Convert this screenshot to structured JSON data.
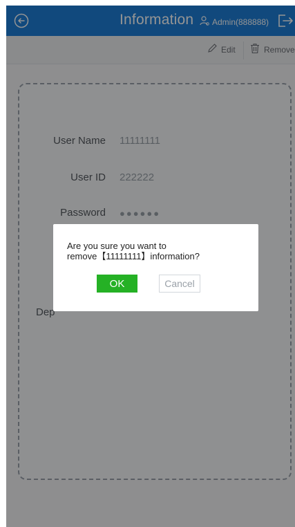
{
  "header": {
    "title": "Information",
    "user": "Admin(888888)"
  },
  "toolbar": {
    "edit_label": "Edit",
    "remove_label": "Remove"
  },
  "form": {
    "user_name_label": "User Name",
    "user_name_value": "11111111",
    "user_id_label": "User ID",
    "user_id_value": "222222",
    "password_label": "Password",
    "password_value": "●●●●●●",
    "department_label": "Dep"
  },
  "dialog": {
    "message_line1": "Are you sure you want to",
    "message_line2": "remove【11111111】information?",
    "ok_label": "OK",
    "cancel_label": "Cancel"
  },
  "colors": {
    "header_bg": "#1e7fd8",
    "ok_bg": "#25b125"
  }
}
